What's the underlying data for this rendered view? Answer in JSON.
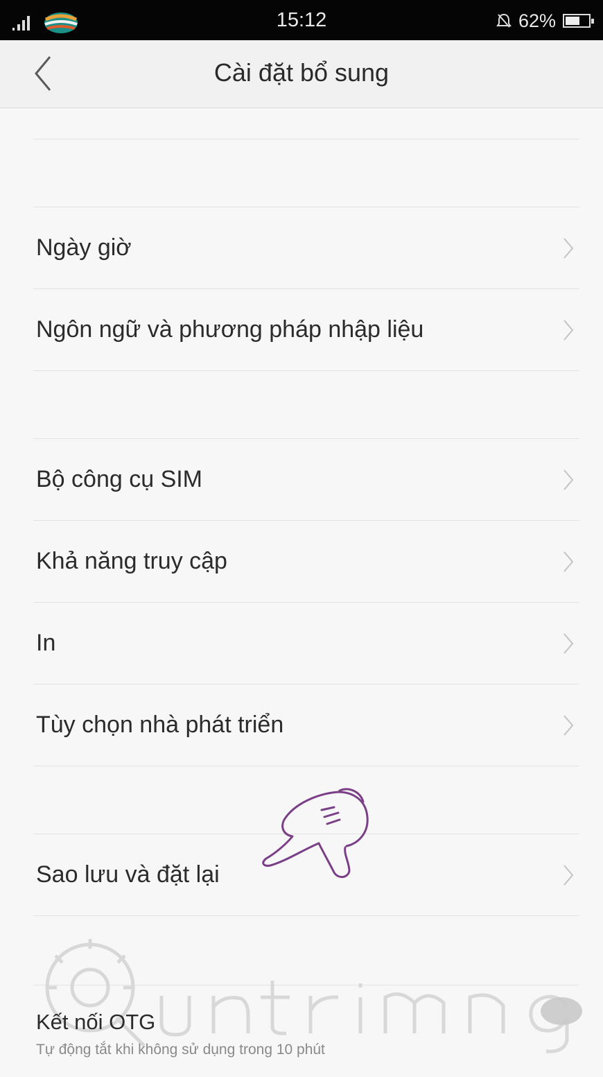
{
  "status_bar": {
    "time": "15:12",
    "battery": "62%",
    "battery_level": 0.62,
    "icons": [
      "signal-icon",
      "carrier-logo-icon",
      "alarm-icon",
      "battery-icon"
    ]
  },
  "header": {
    "title": "Cài đặt bổ sung",
    "back_icon": "chevron-left-icon"
  },
  "settings": {
    "group1": [
      {
        "label": "Ngày giờ"
      },
      {
        "label": "Ngôn ngữ và phương pháp nhập liệu"
      }
    ],
    "group2": [
      {
        "label": "Bộ công cụ SIM"
      },
      {
        "label": "Khả năng truy cập"
      },
      {
        "label": "In"
      },
      {
        "label": "Tùy chọn nhà phát triển"
      }
    ],
    "group3": [
      {
        "label": "Sao lưu và đặt lại"
      }
    ],
    "otg": {
      "title": "Kết nối OTG",
      "subtitle": "Tự động tắt khi không sử dụng trong 10 phút"
    }
  },
  "colors": {
    "background": "#f7f7f7",
    "status_bar": "#050505",
    "divider": "#e3e3e3",
    "annotation": "#7a3f86"
  }
}
